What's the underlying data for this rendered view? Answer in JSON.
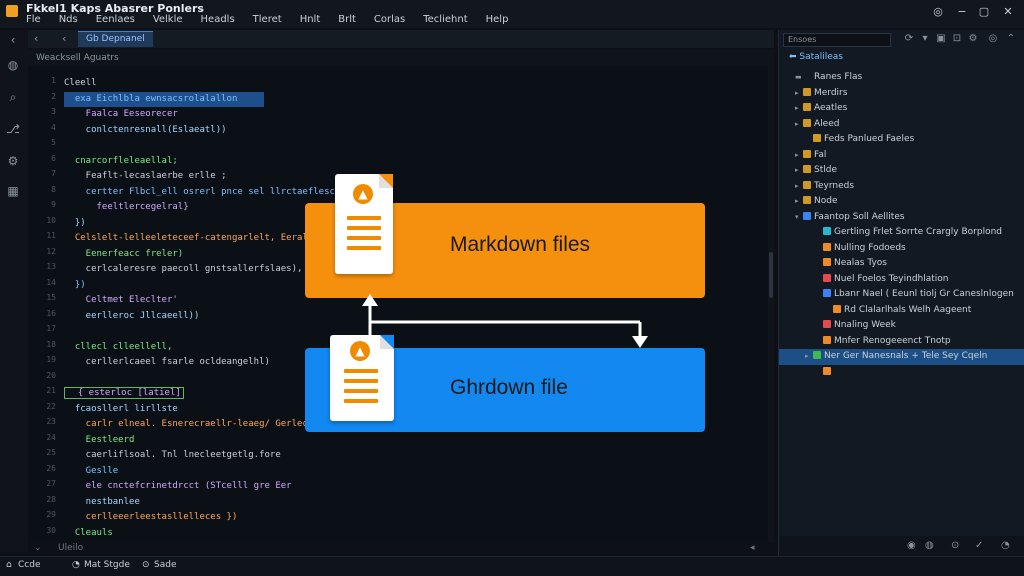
{
  "app": {
    "title": "Fkkel1 Kaps Abasrer Ponlers",
    "menu": [
      "Fle",
      "Nds",
      "Eenlaes",
      "Velkle",
      "Headls",
      "Tleret",
      "Hnlt",
      "Brlt",
      "Corlas",
      "Tecliehnt",
      "Help"
    ]
  },
  "editor": {
    "tab_label": "Gb Depnanel",
    "breadcrumb": "Weacksell Aguatrs",
    "line_numbers": [
      "1",
      "2",
      "3",
      "4",
      "5",
      "6",
      "7",
      "8",
      "9",
      "10",
      "11",
      "12",
      "13",
      "14",
      "15",
      "16",
      "17",
      "18",
      "19",
      "20",
      "21",
      "22",
      "23",
      "24",
      "25",
      "26",
      "27",
      "28",
      "29",
      "30"
    ],
    "code_lines": [
      "Cleell",
      "  exa Eichlbla ewnsacsrolalallon",
      "    Faalca Eeseorecer",
      "    conlctenresnall(Eslaeatl))",
      "  ",
      "  cnarcorfleleaellal;",
      "    Feaflt-lecaslaerbe erlle ;",
      "    certter Flbcl_ell osrerl pnce sel llrctaeflesclls, ?l)",
      "      feeltlercegelral}",
      "  })",
      "  Celslelt-lelleeleteceef-catengarlelt, Eerall fnl",
      "    Eenerfeacc freler)",
      "    cerlcaleresre paecoll gnstsallerfslaes),",
      "  })",
      "    Celtmet Eleclter'",
      "    eerlleroc Jllcaeell))",
      "  ",
      "  cllecl clleellell,",
      "    cerllerlcaeel fsarle ocldeangelhl)",
      "  ",
      "  { esterloc [latiel]",
      "  fcaosllerl lirllste",
      "    carlr elneal. Esnerecraellr-leaeg/ Gerleclalle:",
      "    Eestleerd",
      "    caerliflsoal. Tnl lnecleetgetlg.fore",
      "    Geslle",
      "    ele cnctefcrinetdrcct (STcelll gre Eer",
      "    nestbanlee",
      "    cerlleeerleestasllelleces })",
      "  Cleauls"
    ],
    "footer": "Uleilo"
  },
  "diagram": {
    "top_label": "Markdown files",
    "bottom_label": "Ghrdown file",
    "colors": {
      "top": "#f5900f",
      "bottom": "#1288f0"
    }
  },
  "sidebar": {
    "search_placeholder": "Ensoes",
    "header": "Satalileas",
    "items": [
      {
        "label": "Ranes Flas",
        "indent": 1,
        "twisty": "▬",
        "icon": "none"
      },
      {
        "label": "Merdirs",
        "indent": 1,
        "twisty": "▸",
        "icon": "folder"
      },
      {
        "label": "Aeatles",
        "indent": 1,
        "twisty": "▸",
        "icon": "folder"
      },
      {
        "label": "Aleed",
        "indent": 1,
        "twisty": "▸",
        "icon": "folder"
      },
      {
        "label": "Feds Panlued Faeles",
        "indent": 2,
        "twisty": "",
        "icon": "folder"
      },
      {
        "label": "Fal",
        "indent": 1,
        "twisty": "▸",
        "icon": "folder"
      },
      {
        "label": "Stlde",
        "indent": 1,
        "twisty": "▸",
        "icon": "folder"
      },
      {
        "label": "Teyrneds",
        "indent": 1,
        "twisty": "▸",
        "icon": "folder"
      },
      {
        "label": "Node",
        "indent": 1,
        "twisty": "▸",
        "icon": "folder"
      },
      {
        "label": "Faantop Soll Aellites",
        "indent": 1,
        "twisty": "▾",
        "icon": "blue"
      },
      {
        "label": "Gertling Frlet Sorrte Crargly Borplond",
        "indent": 3,
        "twisty": "",
        "icon": "cyan"
      },
      {
        "label": "Nulling Fodoeds",
        "indent": 3,
        "twisty": "",
        "icon": "orange"
      },
      {
        "label": "Nealas Tyos",
        "indent": 3,
        "twisty": "",
        "icon": "orange"
      },
      {
        "label": "Nuel Foelos Teyindhlation",
        "indent": 3,
        "twisty": "",
        "icon": "red"
      },
      {
        "label": "Lbanr Nael ( Eeunl tiolj Gr Caneslnlogen",
        "indent": 3,
        "twisty": "",
        "icon": "blue"
      },
      {
        "label": "Rd Clalarlhals Welh Aageent",
        "indent": 4,
        "twisty": "",
        "icon": "orange"
      },
      {
        "label": "Nnaling Week",
        "indent": 3,
        "twisty": "",
        "icon": "red"
      },
      {
        "label": "Mnfer Renogeeenct Tnotp",
        "indent": 3,
        "twisty": "",
        "icon": "orange"
      },
      {
        "label": "Ner Ger Nanesnals + Tele Sey Cqeln",
        "indent": 2,
        "twisty": "▸",
        "icon": "green",
        "selected": true
      },
      {
        "label": "",
        "indent": 3,
        "twisty": "",
        "icon": "orange"
      }
    ]
  },
  "statusbar": {
    "left": [
      "Ccde",
      "Mat Stgde",
      "Sade"
    ]
  }
}
